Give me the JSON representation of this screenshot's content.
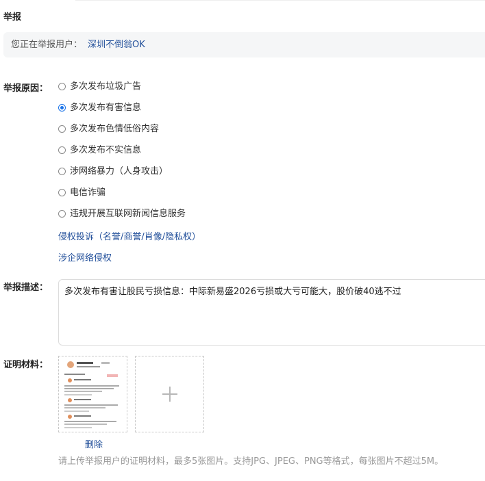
{
  "header": {
    "title": "举报"
  },
  "target": {
    "prefix": "您正在举报用户：",
    "user_name": "深圳不倒翁OK"
  },
  "reason": {
    "label": "举报原因：",
    "options": [
      {
        "label": "多次发布垃圾广告",
        "checked": false
      },
      {
        "label": "多次发布有害信息",
        "checked": true
      },
      {
        "label": "多次发布色情低俗内容",
        "checked": false
      },
      {
        "label": "多次发布不实信息",
        "checked": false
      },
      {
        "label": "涉网络暴力（人身攻击）",
        "checked": false
      },
      {
        "label": "电信诈骗",
        "checked": false
      },
      {
        "label": "违规开展互联网新闻信息服务",
        "checked": false
      }
    ],
    "links": [
      "侵权投诉（名誉/商誉/肖像/隐私权）",
      "涉企网络侵权"
    ]
  },
  "description": {
    "label": "举报描述：",
    "value": "多次发布有害让股民亏损信息：中际新易盛2026亏损或大亏可能大，股价破40逃不过"
  },
  "evidence": {
    "label": "证明材料：",
    "delete_label": "删除",
    "hint": "请上传举报用户的证明材料，最多5张图片。支持JPG、JPEG、PNG等格式，每张图片不超过5M。"
  },
  "colors": {
    "link": "#1f4d99",
    "radio_checked": "#1a73e8",
    "hint": "#999999"
  },
  "icons": {
    "add": "plus-icon"
  }
}
